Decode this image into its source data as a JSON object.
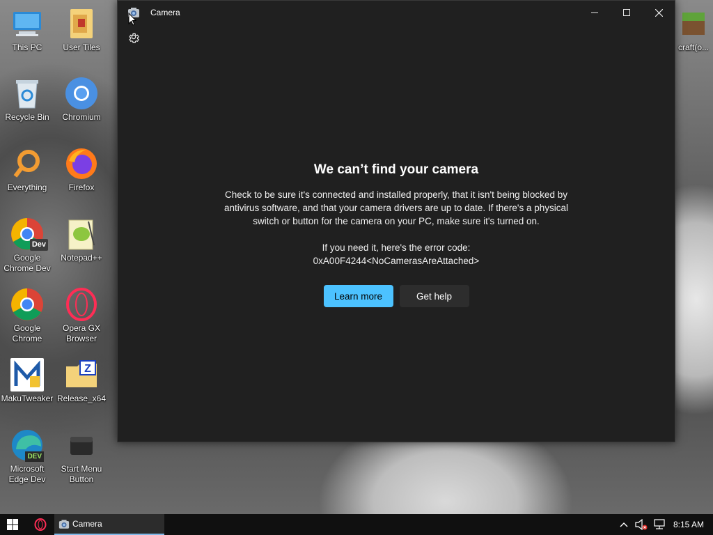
{
  "desktop": {
    "icons": [
      {
        "label": "This PC",
        "icon": "monitor-icon"
      },
      {
        "label": "User Tiles",
        "icon": "folder-icon"
      },
      {
        "label": "Recycle Bin",
        "icon": "recycle-bin-icon"
      },
      {
        "label": "Chromium",
        "icon": "chromium-icon"
      },
      {
        "label": "Everything",
        "icon": "everything-search-icon"
      },
      {
        "label": "Firefox",
        "icon": "firefox-icon"
      },
      {
        "label": "Google Chrome Dev",
        "icon": "chrome-dev-icon"
      },
      {
        "label": "Notepad++",
        "icon": "notepad-plus-plus-icon"
      },
      {
        "label": "Google Chrome",
        "icon": "chrome-icon"
      },
      {
        "label": "Opera GX Browser",
        "icon": "opera-gx-icon"
      },
      {
        "label": "MakuTweaker",
        "icon": "makutweaker-icon"
      },
      {
        "label": "Release_x64",
        "icon": "zip-folder-icon"
      },
      {
        "label": "Microsoft Edge Dev",
        "icon": "edge-dev-icon"
      },
      {
        "label": "Start Menu Button",
        "icon": "start-menu-button-icon"
      },
      {
        "label": "craft(o...",
        "icon": "minecraft-icon"
      }
    ],
    "badge_dev": "Dev",
    "badge_dev_edge": "DEV"
  },
  "window": {
    "title": "Camera",
    "controls": {
      "minimize": "minimize-icon",
      "maximize": "maximize-icon",
      "close": "close-icon"
    },
    "settings_icon": "gear-icon"
  },
  "error": {
    "heading": "We can’t find your camera",
    "message": "Check to be sure it's connected and installed properly, that it isn't being blocked by antivirus software, and that your camera drivers are up to date. If there's a physical switch or button for the camera on your PC, make sure it's turned on.",
    "code_intro": "If you need it, here's the error code:",
    "code": "0xA00F4244<NoCamerasAreAttached>",
    "learn_more": "Learn more",
    "get_help": "Get help"
  },
  "taskbar": {
    "camera_label": "Camera",
    "time": "8:15 AM"
  },
  "colors": {
    "window_bg": "#202020",
    "primary_button": "#4cc2ff",
    "secondary_button": "#2d2d2d",
    "taskbar_bg": "#101010"
  }
}
